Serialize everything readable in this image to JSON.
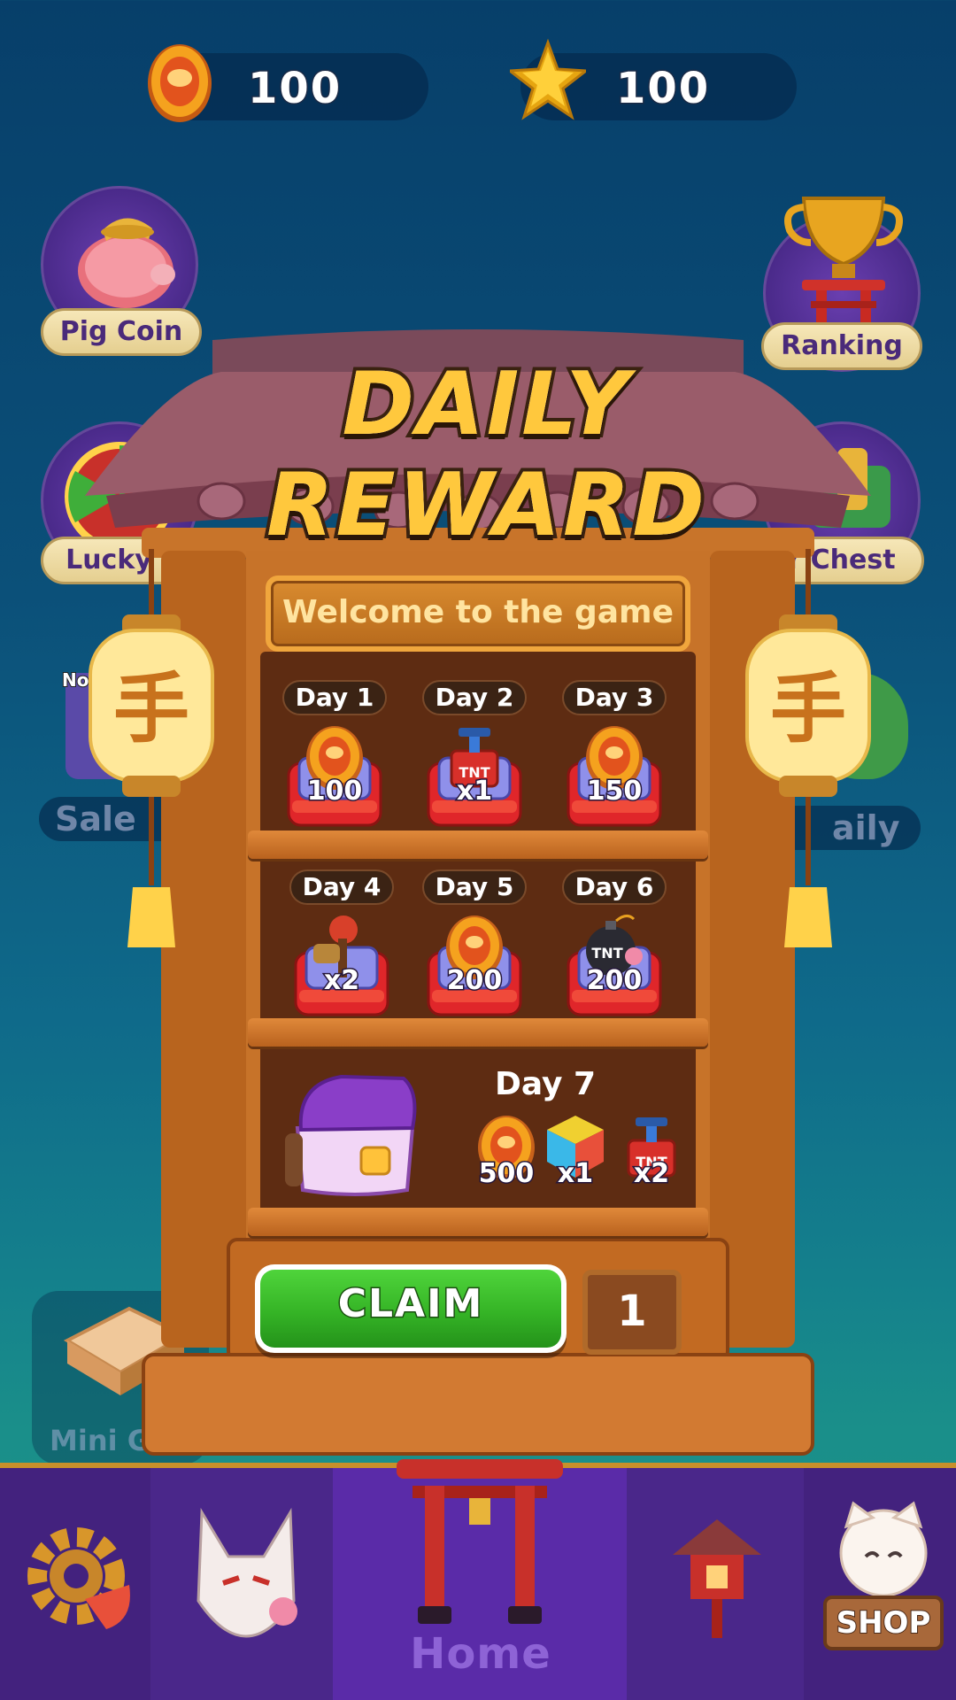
{
  "currencies": {
    "coins": "100",
    "stars": "100"
  },
  "features": {
    "pig_coin": "Pig Coin",
    "ranking": "Ranking",
    "lucky_spin": "Lucky S",
    "star_chest": "r Chest",
    "sale": "Sale",
    "sale_tag": "No",
    "daily": "aily",
    "mini_game": "Mini G"
  },
  "popup": {
    "title": "DAILY REWARD",
    "welcome": "Welcome to the game",
    "lantern_glyph": "手",
    "days": [
      {
        "label": "Day 1",
        "reward": "coin",
        "value": "100"
      },
      {
        "label": "Day 2",
        "reward": "tnt",
        "value": "x1"
      },
      {
        "label": "Day 3",
        "reward": "coin",
        "value": "150"
      },
      {
        "label": "Day 4",
        "reward": "hammer",
        "value": "x2"
      },
      {
        "label": "Day 5",
        "reward": "coin",
        "value": "200"
      },
      {
        "label": "Day 6",
        "reward": "bomb",
        "value": "200"
      }
    ],
    "day7": {
      "label": "Day 7",
      "items": [
        {
          "reward": "coin",
          "value": "500"
        },
        {
          "reward": "rainbow-cube",
          "value": "x1"
        },
        {
          "reward": "tnt",
          "value": "x2"
        }
      ],
      "tnt_text": "TNT"
    },
    "claim_label": "CLAIM",
    "counter": "1"
  },
  "nav": {
    "home_label": "Home",
    "shop_label": "SHOP",
    "items": [
      "settings",
      "avatar",
      "home",
      "shrine",
      "shop"
    ]
  }
}
